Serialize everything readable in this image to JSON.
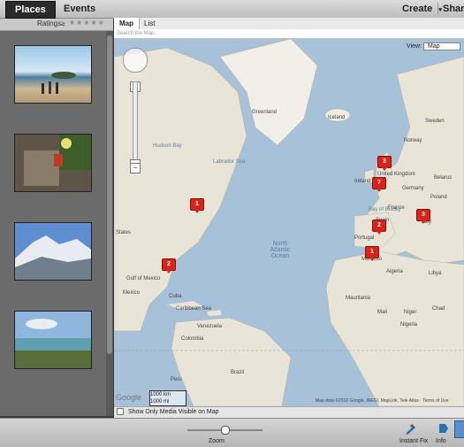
{
  "tabs": {
    "places": "Places",
    "events": "Events"
  },
  "toolbar": {
    "create": "Create",
    "share": "Share"
  },
  "ratings": {
    "label": "Ratings",
    "value": "≥",
    "stars": "★★★★★"
  },
  "map_tabs": {
    "map": "Map",
    "list": "List"
  },
  "search": {
    "placeholder": "Search the Map..."
  },
  "map_view": {
    "label": "View:",
    "value": "Map"
  },
  "map_labels": {
    "greenland": "Greenland",
    "iceland": "Iceland",
    "norway": "Norway",
    "sweden": "Sweden",
    "united_kingdom": "United Kingdom",
    "ireland": "Ireland",
    "germany": "Germany",
    "belarus": "Belarus",
    "poland": "Poland",
    "france": "France",
    "portugal": "Portugal",
    "spain": "Spain",
    "italy": "Italy",
    "morocco": "Morocco",
    "algeria": "Algeria",
    "libya": "Libya",
    "mauritania": "Mauritania",
    "mali": "Mali",
    "niger": "Niger",
    "chad": "Chad",
    "nigeria": "Nigeria",
    "states": "States",
    "gulf_of_mexico": "Gulf of Mexico",
    "caribbean_sea": "Caribbean Sea",
    "venezuela": "Venezuela",
    "colombia": "Colombia",
    "peru": "Peru",
    "brazil": "Brazil",
    "hudson_bay": "Hudson Bay",
    "labrador_sea": "Labrador Sea",
    "bay_of_biscay": "Bay of Biscay",
    "north_atlantic_ocean": "North Atlantic Ocean",
    "mexico": "Mexico",
    "cuba": "Cuba"
  },
  "pins": [
    {
      "id": "pin-us-northeast",
      "count": "1"
    },
    {
      "id": "pin-florida",
      "count": "2"
    },
    {
      "id": "pin-scotland",
      "count": "3"
    },
    {
      "id": "pin-uk",
      "count": "7"
    },
    {
      "id": "pin-spain",
      "count": "2"
    },
    {
      "id": "pin-italy",
      "count": "3"
    },
    {
      "id": "pin-morocco",
      "count": "1"
    }
  ],
  "map_scale": {
    "km": "1000 km",
    "mi": "1000 mi"
  },
  "attribution": "Map data ©2012 Google, INEGI, MapLink, Tele Atlas · Terms of Use",
  "google_logo": "Google",
  "show_only": "Show Only Media Visible on Map",
  "footer": {
    "zoom": "Zoom",
    "instant_fix": "Instant Fix",
    "info": "Info"
  },
  "colors": {
    "pin": "#d8241b",
    "ocean": "#a7c1d9",
    "land": "#e8e4d8"
  }
}
